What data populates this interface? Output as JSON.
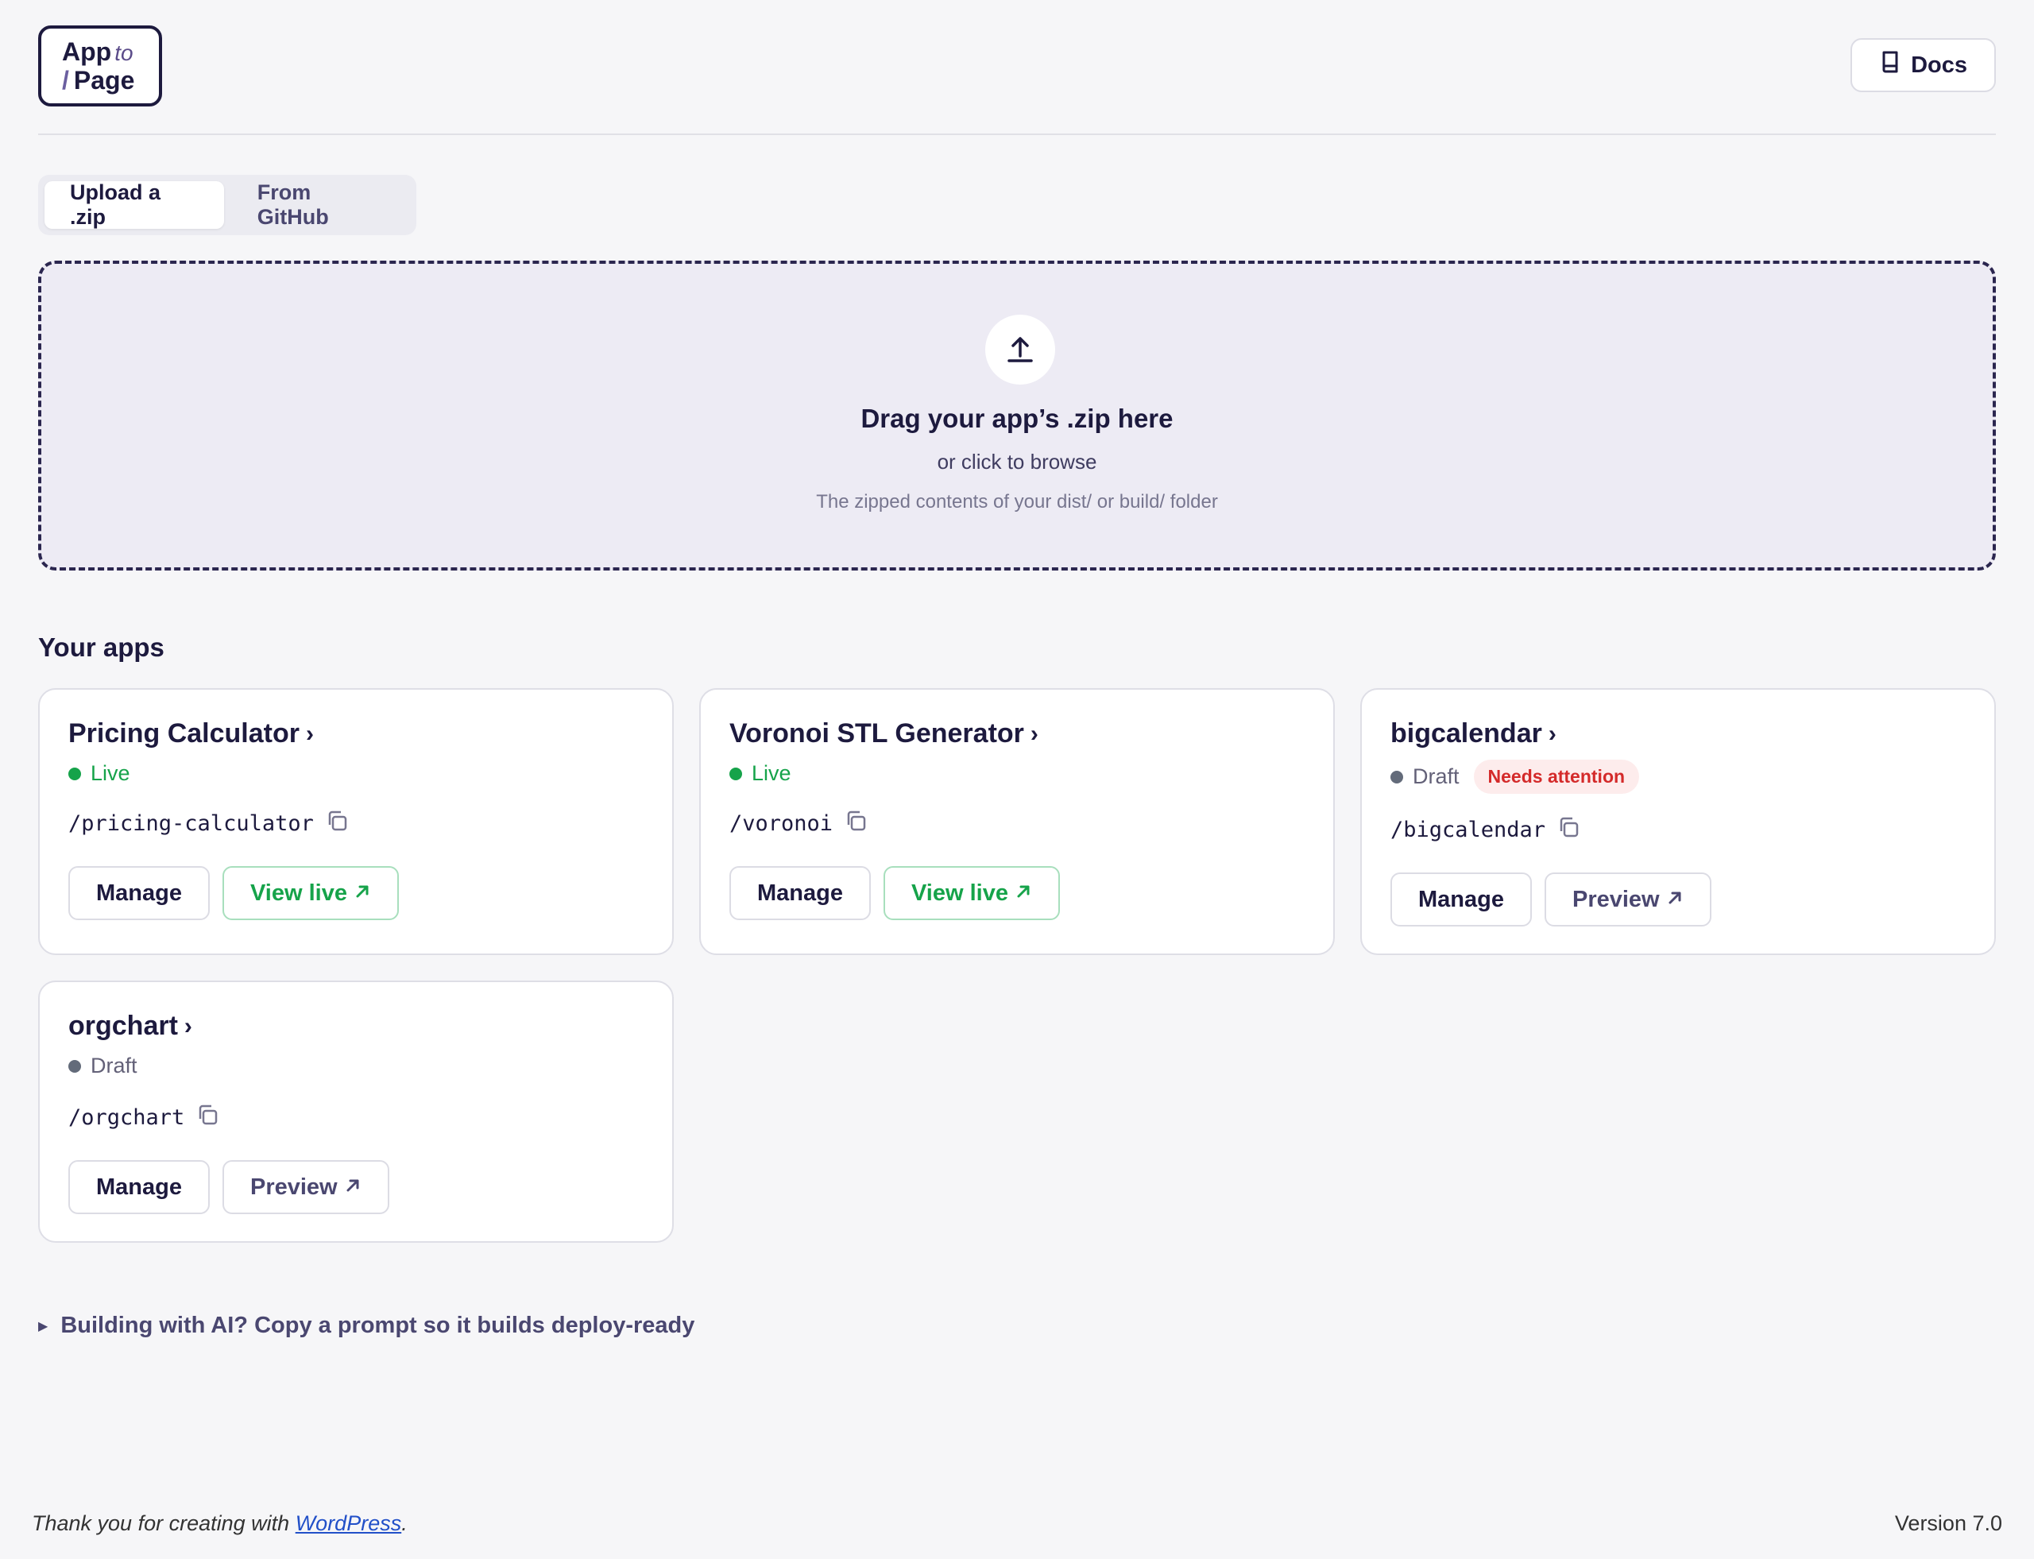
{
  "header": {
    "logo": {
      "line1_main": "App",
      "line1_italic": "to",
      "line2_slash": "/",
      "line2_main": "Page"
    },
    "docs_label": "Docs",
    "icons": {
      "docs": "book-icon"
    }
  },
  "tabs": [
    {
      "label": "Upload a .zip",
      "active": true
    },
    {
      "label": "From GitHub",
      "active": false
    }
  ],
  "dropzone": {
    "title": "Drag your app’s .zip here",
    "subtitle": "or click to browse",
    "hint": "The zipped contents of your dist/ or build/ folder",
    "icon": "upload-icon"
  },
  "apps_section": {
    "title": "Your apps",
    "apps": [
      {
        "name": "Pricing Calculator",
        "status": "Live",
        "badge": "",
        "slug": "/pricing-calculator",
        "manage_label": "Manage",
        "action_label": "View live"
      },
      {
        "name": "Voronoi STL Generator",
        "status": "Live",
        "badge": "",
        "slug": "/voronoi",
        "manage_label": "Manage",
        "action_label": "View live"
      },
      {
        "name": "bigcalendar",
        "status": "Draft",
        "badge": "Needs attention",
        "slug": "/bigcalendar",
        "manage_label": "Manage",
        "action_label": "Preview"
      },
      {
        "name": "orgchart",
        "status": "Draft",
        "badge": "",
        "slug": "/orgchart",
        "manage_label": "Manage",
        "action_label": "Preview"
      }
    ]
  },
  "disclosure": {
    "label": "Building with AI? Copy a prompt so it builds deploy-ready"
  },
  "footer": {
    "thanks_prefix": "Thank you for creating with",
    "thanks_link": "WordPress",
    "thanks_suffix": ".",
    "version": "Version 7.0"
  },
  "colors": {
    "brand": "#1d1a3e",
    "live": "#16a34a",
    "attention": "#d42a2a",
    "link": "#2250c8"
  }
}
